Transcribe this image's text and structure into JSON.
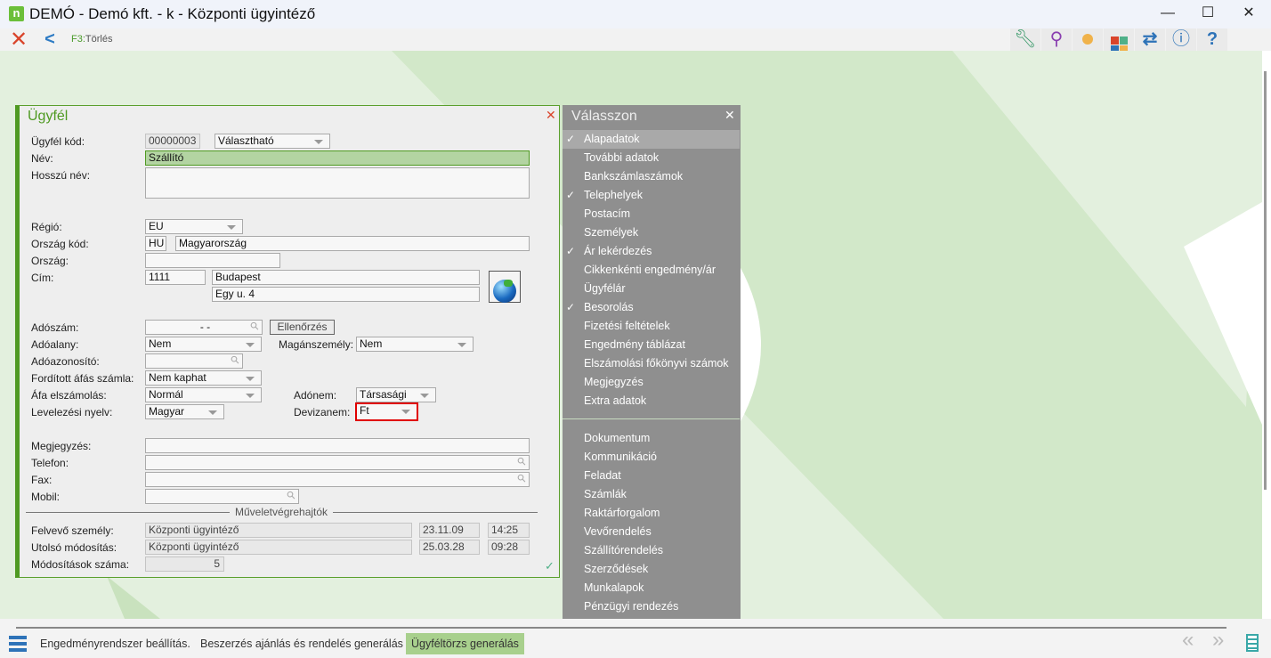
{
  "window": {
    "title": "DEMÓ - Demó kft. - k - Központi ügyintéző",
    "logo": "n",
    "minimize": "—",
    "maximize": "☐",
    "close": "✕"
  },
  "toolbar": {
    "delete_key": "F3:",
    "delete_label": "Törlés",
    "icons": [
      "close-icon",
      "back-icon",
      "wrench-icon",
      "search-icon",
      "user-icon",
      "tiles-icon",
      "swap-icon",
      "info-icon",
      "help-icon"
    ]
  },
  "form": {
    "title": "Ügyfél",
    "labels": {
      "code": "Ügyfél kód:",
      "name": "Név:",
      "long_name": "Hosszú név:",
      "region": "Régió:",
      "country_code": "Ország kód:",
      "country": "Ország:",
      "address": "Cím:",
      "tax_number": "Adószám:",
      "taxable": "Adóalany:",
      "private_person": "Magánszemély:",
      "tax_id": "Adóazonosító:",
      "reverse_vat": "Fordított áfás számla:",
      "vat_accounting": "Áfa elszámolás:",
      "tax_type": "Adónem:",
      "language": "Levelezési nyelv:",
      "currency": "Devizanem:",
      "note": "Megjegyzés:",
      "phone": "Telefon:",
      "fax": "Fax:",
      "mobile": "Mobil:",
      "operators_section": "Műveletvégrehajtók",
      "created_by": "Felvevő személy:",
      "modified_by": "Utolsó módosítás:",
      "modification_count": "Módosítások száma:"
    },
    "values": {
      "code": "00000003",
      "code_type": "Választható",
      "name": "Szállító",
      "long_name": "",
      "region": "EU",
      "country_code": "HU",
      "country_name": "Magyarország",
      "country": "",
      "zip": "1111",
      "city": "Budapest",
      "street": "Egy u. 4",
      "tax_number": "- -",
      "taxable": "Nem",
      "private_person": "Nem",
      "tax_id": "",
      "reverse_vat": "Nem kaphat",
      "vat_accounting": "Normál",
      "tax_type": "Társasági",
      "language": "Magyar",
      "currency": "Ft",
      "note": "",
      "phone": "",
      "fax": "",
      "mobile": "",
      "created_by": "Központi ügyintéző",
      "created_date": "23.11.09",
      "created_time": "14:25",
      "modified_by": "Központi ügyintéző",
      "modified_date": "25.03.28",
      "modified_time": "09:28",
      "modification_count": "5"
    },
    "check_button": "Ellenőrzés",
    "highlight_color": "#e00000",
    "accent": "#4f9a22"
  },
  "menu": {
    "title": "Válasszon",
    "close": "✕",
    "check": "✓",
    "items": [
      {
        "label": "Alapadatok",
        "checked": true,
        "selected": true
      },
      {
        "label": "További adatok",
        "checked": false
      },
      {
        "label": "Bankszámlaszámok",
        "checked": false
      },
      {
        "label": "Telephelyek",
        "checked": true
      },
      {
        "label": "Postacím",
        "checked": false
      },
      {
        "label": "Személyek",
        "checked": false
      },
      {
        "label": "Ár lekérdezés",
        "checked": true
      },
      {
        "label": "Cikkenkénti engedmény/ár",
        "checked": false
      },
      {
        "label": "Ügyfélár",
        "checked": false
      },
      {
        "label": "Besorolás",
        "checked": true
      },
      {
        "label": "Fizetési feltételek",
        "checked": false
      },
      {
        "label": "Engedmény táblázat",
        "checked": false
      },
      {
        "label": "Elszámolási főkönyvi számok",
        "checked": false
      },
      {
        "label": "Megjegyzés",
        "checked": false
      },
      {
        "label": "Extra adatok",
        "checked": false
      }
    ],
    "related": [
      "Dokumentum",
      "Kommunikáció",
      "Feladat",
      "Számlák",
      "Raktárforgalom",
      "Vevőrendelés",
      "Szállítórendelés",
      "Szerződések",
      "Munkalapok",
      "Pénzügyi rendezés"
    ]
  },
  "bottom_tabs": [
    {
      "label": "Engedményrendszer beállítás.",
      "active": false
    },
    {
      "label": "Beszerzés ajánlás és rendelés generálás",
      "active": false
    },
    {
      "label": "Ügyféltörzs generálás",
      "active": true
    }
  ]
}
